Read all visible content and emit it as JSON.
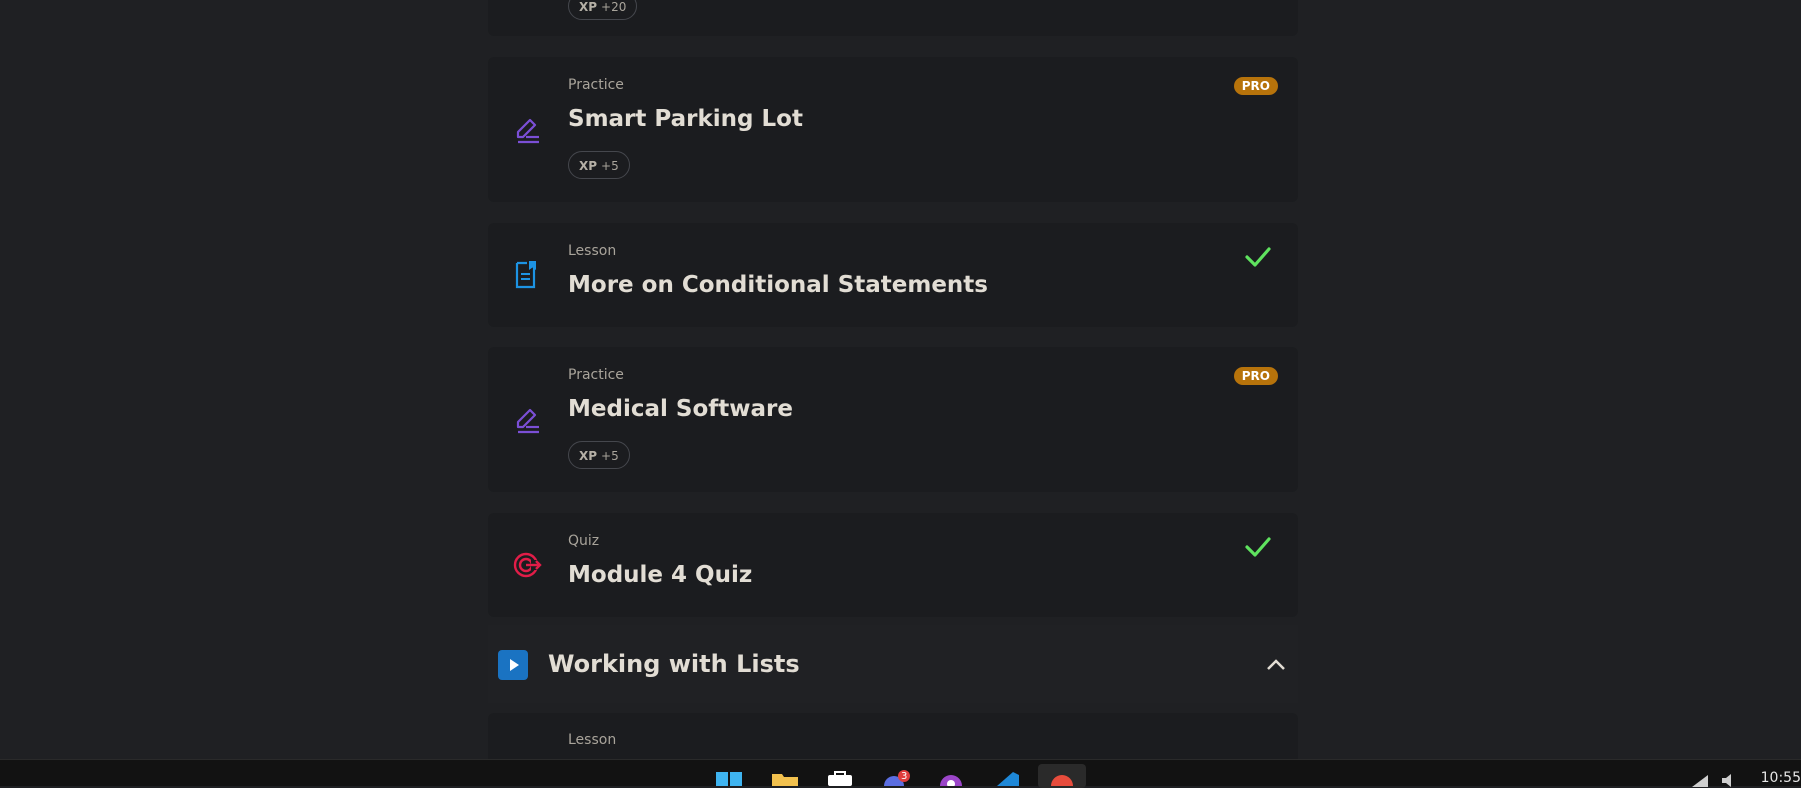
{
  "cards": [
    {
      "xp": "+20",
      "xp_label": "XP"
    },
    {
      "type": "Practice",
      "title": "Smart Parking Lot",
      "xp_label": "XP",
      "xp": "+5",
      "badge": "PRO",
      "icon": "pencil-lines-icon",
      "accent": "#7b4fd6"
    },
    {
      "type": "Lesson",
      "title": "More on Conditional Statements",
      "status": "completed",
      "icon": "lesson-bookmark-icon",
      "accent": "#1d93e3"
    },
    {
      "type": "Practice",
      "title": "Medical Software",
      "xp_label": "XP",
      "xp": "+5",
      "badge": "PRO",
      "icon": "pencil-lines-icon",
      "accent": "#7b4fd6"
    },
    {
      "type": "Quiz",
      "title": "Module 4 Quiz",
      "status": "completed",
      "icon": "target-icon",
      "accent": "#e11d48"
    }
  ],
  "section": {
    "title": "Working with Lists",
    "icon": "play-icon",
    "expanded": true
  },
  "next_card": {
    "type": "Lesson"
  },
  "taskbar": {
    "notification_count": "3",
    "clock": "10:55"
  },
  "colors": {
    "check": "#5fe35f",
    "pro": "#b7730b"
  }
}
